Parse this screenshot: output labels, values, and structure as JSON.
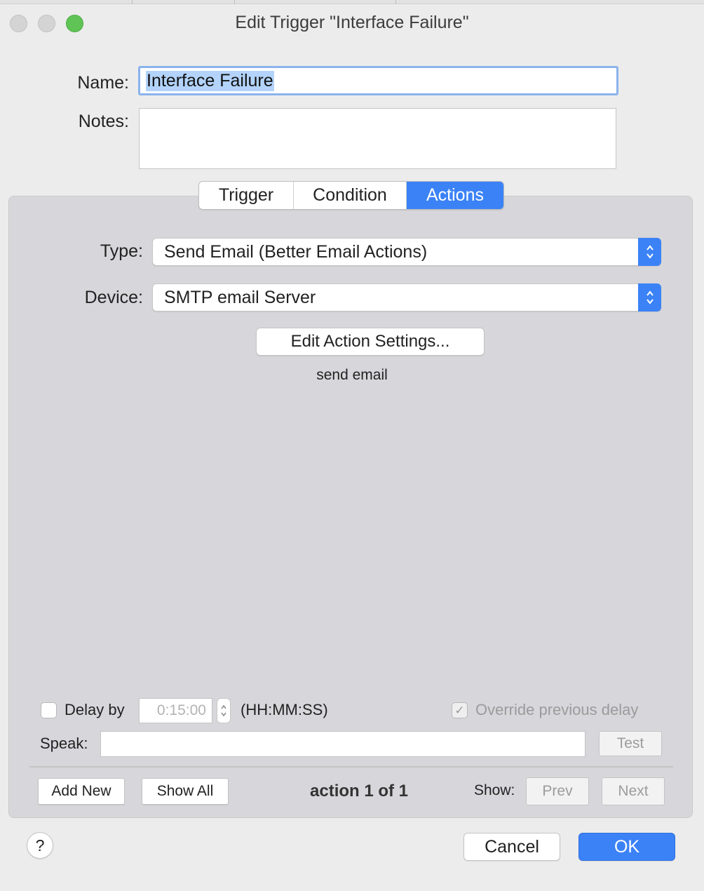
{
  "window": {
    "title": "Edit Trigger \"Interface Failure\""
  },
  "form": {
    "name_label": "Name:",
    "name_value": "Interface Failure",
    "notes_label": "Notes:",
    "notes_value": ""
  },
  "tabs": [
    {
      "label": "Trigger",
      "selected": false
    },
    {
      "label": "Condition",
      "selected": false
    },
    {
      "label": "Actions",
      "selected": true
    }
  ],
  "actions": {
    "type_label": "Type:",
    "type_value": "Send Email (Better Email Actions)",
    "device_label": "Device:",
    "device_value": "SMTP email Server",
    "edit_settings_button": "Edit Action Settings...",
    "description": "send email",
    "delay_label": "Delay by",
    "delay_checked": false,
    "delay_value": "0:15:00",
    "delay_format": "(HH:MM:SS)",
    "override_label": "Override previous delay",
    "override_checked": true,
    "speak_label": "Speak:",
    "speak_value": "",
    "test_button": "Test",
    "add_new_button": "Add New",
    "show_all_button": "Show All",
    "counter": "action 1 of 1",
    "show_label": "Show:",
    "prev_button": "Prev",
    "next_button": "Next"
  },
  "footer": {
    "help_label": "?",
    "cancel_button": "Cancel",
    "ok_button": "OK"
  },
  "colors": {
    "accent": "#3b82f6",
    "zoom_light": "#5fc455",
    "selection": "#b3d3fb"
  }
}
